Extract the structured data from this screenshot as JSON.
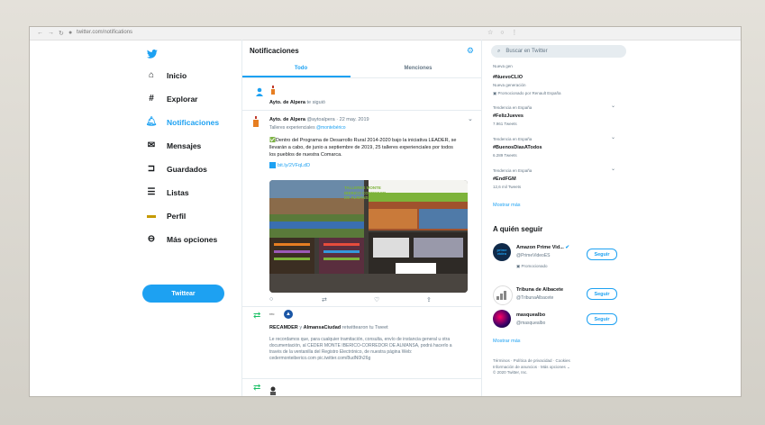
{
  "browser": {
    "url": "twitter.com/notifications"
  },
  "nav": {
    "0": {
      "label": "Inicio"
    },
    "1": {
      "label": "Explorar"
    },
    "2": {
      "label": "Notificaciones"
    },
    "3": {
      "label": "Mensajes"
    },
    "4": {
      "label": "Guardados"
    },
    "5": {
      "label": "Listas"
    },
    "6": {
      "label": "Perfil"
    },
    "7": {
      "label": "Más opciones"
    },
    "tweet_button": "Twittear"
  },
  "center": {
    "title": "Notificaciones",
    "tabs": [
      "Todo",
      "Menciones"
    ],
    "follow": {
      "name": "Ayto. de Alpera",
      "text": "te siguió"
    },
    "tweet": {
      "name": "Ayto. de Alpera",
      "handle": "@aytoalpera",
      "date": "· 22 may. 2019",
      "context_prefix": "Talleres experienciales",
      "context_link": "@montebérico",
      "text": "Dentro del Programa de Desarrollo Rural 2014-2020 bajo la iniciativa LEADER, se llevarán a cabo, de junio a septiembre de 2019, 25 talleres experienciales por todos los pueblos de nuestra Comarca.",
      "link": "bit.ly/2VFqLdD",
      "image_caption": "TALLERES MONTE IBERICO CORREDOR DE ALMANSA"
    },
    "retweet": {
      "avatar_text": "rec",
      "user1": "RECAMDER",
      "conj": "y",
      "user2": "AlmansaCiudad",
      "text": "retwittearon tu Tweet",
      "quoted": "Le recordamos que, para cualquier tramitación, consulta, envío de instancia general u otra documentación, al CEDER MONTE IBERICO-CORREDOR DE ALMANSA, podrá hacerlo a través de la ventanilla del Registro Electrónico, de nuestra página Web: cedermonteiberico.com pic.twitter.com/8udN0h26g"
    }
  },
  "right": {
    "search_placeholder": "Buscar en Twitter",
    "trends": [
      {
        "context": "Nueva gen",
        "name": "#NuevoCLIO",
        "count": "Nueva generación",
        "promoted": "Promocionado por Renault España"
      },
      {
        "context": "Tendencia en España",
        "name": "#FelizJueves",
        "count": "7.961 Tweets"
      },
      {
        "context": "Tendencia en España",
        "name": "#BuenosDiasATodos",
        "count": "6.289 Tweets"
      },
      {
        "context": "Tendencia en España",
        "name": "#EndFGM",
        "count": "12,6 mil Tweets"
      }
    ],
    "show_more": "Mostrar más",
    "who_to_follow_title": "A quién seguir",
    "follow_label": "Seguir",
    "suggestions": [
      {
        "name": "Amazon Prime Vid...",
        "handle": "@PrimeVideoES",
        "promoted": "Promocionado"
      },
      {
        "name": "Tribuna de Albacete",
        "handle": "@TribunaAlbacete"
      },
      {
        "name": "masquealbo",
        "handle": "@masquealbo"
      }
    ],
    "footer": {
      "line1": "Términos · Política de privacidad · Cookies",
      "line2": "Información de anuncios · Más opciones ⌄",
      "line3": "© 2020 Twitter, Inc."
    }
  }
}
